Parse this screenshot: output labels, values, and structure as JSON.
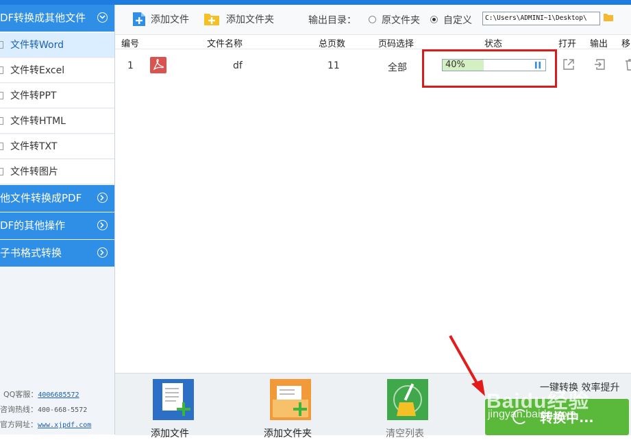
{
  "sidebar": {
    "sections": [
      {
        "label": "DF转换成其他文件",
        "expanded": true
      },
      {
        "label": "他文件转换成PDF",
        "expanded": false
      },
      {
        "label": "DF的其他操作",
        "expanded": false
      },
      {
        "label": "子书格式转换",
        "expanded": false
      }
    ],
    "items": [
      {
        "label": "文件转Word",
        "active": true
      },
      {
        "label": "文件转Excel",
        "active": false
      },
      {
        "label": "文件转PPT",
        "active": false
      },
      {
        "label": "文件转HTML",
        "active": false
      },
      {
        "label": "文件转TXT",
        "active": false
      },
      {
        "label": "文件转图片",
        "active": false
      }
    ],
    "contact": {
      "qq_label": "QQ客服：",
      "qq_value": "4006685572",
      "hotline_label": "咨询热线：",
      "hotline_value": "400-668-5572",
      "site_label": "官方网址：",
      "site_value": "www.xjpdf.com"
    }
  },
  "toolbar": {
    "add_file": "添加文件",
    "add_folder": "添加文件夹",
    "output_label": "输出目录：",
    "option_original": "原文件夹",
    "option_custom": "自定义",
    "selected_option": "自定义",
    "output_path": "C:\\Users\\ADMINI~1\\Desktop\\"
  },
  "table": {
    "headers": {
      "num": "编号",
      "name": "文件名称",
      "pages": "总页数",
      "page_select": "页码选择",
      "status": "状态",
      "open": "打开",
      "output": "输出",
      "remove": "移"
    },
    "rows": [
      {
        "num": "1",
        "name": "df",
        "pages": "11",
        "page_select": "全部",
        "progress_text": "40%",
        "progress": 0.4
      }
    ]
  },
  "bottom": {
    "add_file": "添加文件",
    "add_folder": "添加文件夹",
    "clear_list": "清空列表",
    "slogan": "一键转换 效率提升",
    "convert_button": "转换中..."
  },
  "watermark": {
    "main": "Baidu经验",
    "sub": "jingyan.baidu.com"
  },
  "colors": {
    "accent_blue": "#2f8ee6",
    "convert_green": "#5ab83a",
    "highlight_red": "#d81c1c",
    "progress_fill": "#d4efc1"
  }
}
